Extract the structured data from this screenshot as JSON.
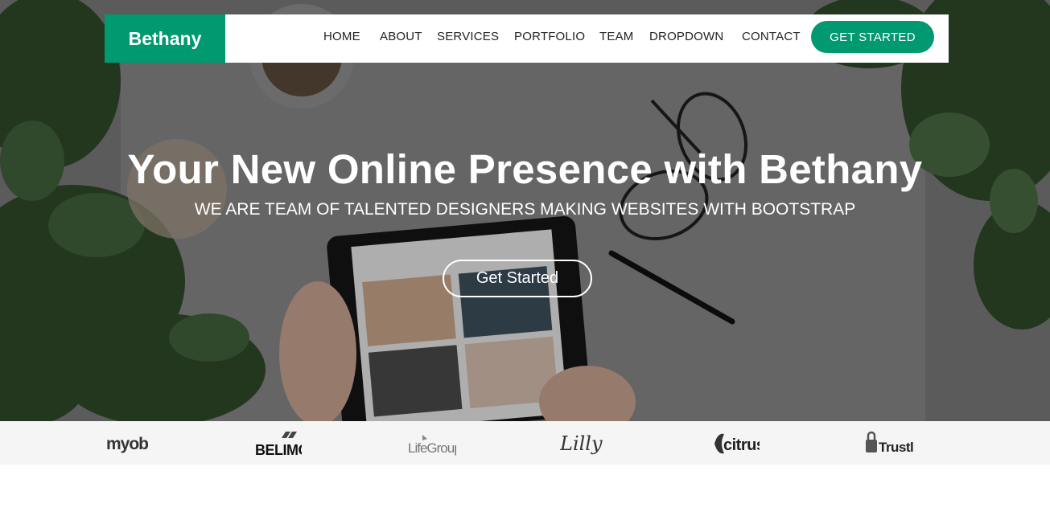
{
  "brand": {
    "name": "Bethany",
    "accent": "#009970"
  },
  "nav": {
    "items": [
      {
        "label": "HOME"
      },
      {
        "label": "ABOUT"
      },
      {
        "label": "SERVICES"
      },
      {
        "label": "PORTFOLIO"
      },
      {
        "label": "TEAM"
      },
      {
        "label": "DROPDOWN"
      },
      {
        "label": "CONTACT"
      }
    ],
    "cta_label": "GET STARTED"
  },
  "hero": {
    "title": "Your New Online Presence with Bethany",
    "subtitle": "WE ARE TEAM OF TALENTED DESIGNERS MAKING WEBSITES WITH BOOTSTRAP",
    "button_label": "Get Started"
  },
  "clients": [
    {
      "name": "myob"
    },
    {
      "name": "BELIMO"
    },
    {
      "name": "LifeGroups"
    },
    {
      "name": "Lilly"
    },
    {
      "name": "citrus"
    },
    {
      "name": "Trustly"
    }
  ]
}
